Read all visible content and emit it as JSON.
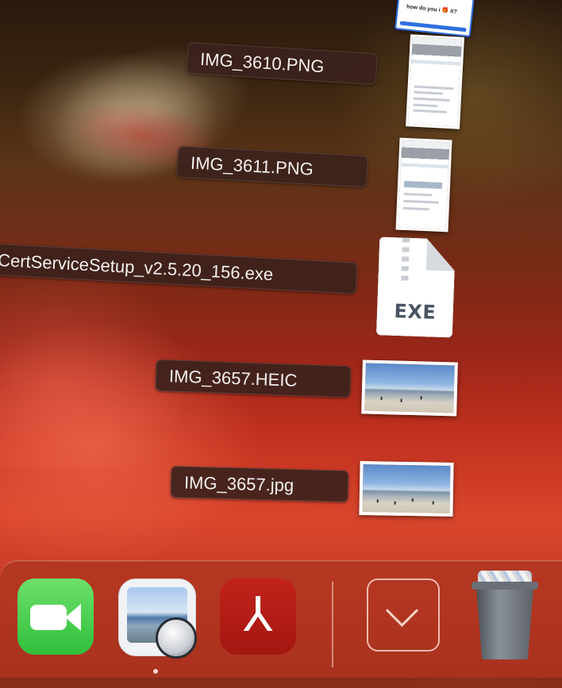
{
  "stack": {
    "items": [
      {
        "label": "IMG_3610.PNG",
        "thumb": "phone-screenshot"
      },
      {
        "label": "IMG_3611.PNG",
        "thumb": "phone-screenshot"
      },
      {
        "label": "CertServiceSetup_v2.5.20_156.exe",
        "thumb": "exe-file-icon",
        "icon_text": "EXE"
      },
      {
        "label": "IMG_3657.HEIC",
        "thumb": "beach-photo"
      },
      {
        "label": "IMG_3657.jpg",
        "thumb": "beach-photo"
      }
    ],
    "partial_top_card_text": "how do you i 🎁 it?"
  },
  "dock": {
    "apps": [
      {
        "name": "FaceTime",
        "icon": "facetime-icon"
      },
      {
        "name": "Preview",
        "icon": "preview-icon",
        "running": true
      },
      {
        "name": "Adobe Acrobat",
        "icon": "acrobat-icon",
        "glyph": "⅄"
      }
    ],
    "downloads_stack_icon": "chevron-down-icon",
    "trash_icon": "trash-full-icon"
  },
  "colors": {
    "label_bg": "#3c221c",
    "dock_bg": "#aa341e",
    "acrobat_red": "#b81d15",
    "facetime_green": "#3ccb48"
  }
}
